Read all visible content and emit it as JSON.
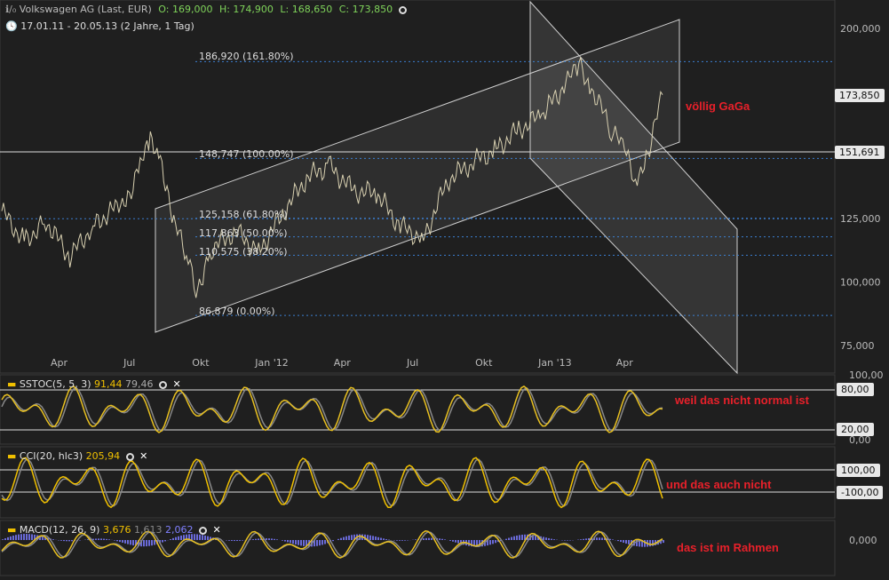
{
  "header": {
    "symbol": "Volkswagen AG (Last, EUR)",
    "open": "O: 169,000",
    "high": "H: 174,900",
    "low": "L: 168,650",
    "close": "C: 173,850",
    "period": "17.01.11 - 20.05.13 (2 Jahre, 1 Tag)",
    "colors": {
      "open": "#7fd35a",
      "high": "#7fd35a",
      "low": "#7fd35a",
      "close": "#7fd35a"
    }
  },
  "main": {
    "price_labels": {
      "current": "173,850",
      "level": "151,691"
    },
    "fib_labels": [
      "186,920 (161.80%)",
      "148,747 (100.00%)",
      "125,158 (61.80%)",
      "117,863 (50.00%)",
      "110,575 (38.20%)",
      "86,879 (0.00%)"
    ],
    "annotation": "völlig GaGa"
  },
  "stoch": {
    "label": "SSTOC(5, 5, 3)",
    "v1": "91,44",
    "v2": "79,46",
    "level_hi": "80,00",
    "level_lo": "20,00",
    "annotation": "weil das nicht normal ist"
  },
  "cci": {
    "label": "CCI(20, hlc3)",
    "v1": "205,94",
    "level_hi": "100,00",
    "level_lo": "-100,00",
    "annotation": "und das auch nicht"
  },
  "macd": {
    "label": "MACD(12, 26, 9)",
    "v1": "3,676",
    "v2": "1,613",
    "v3": "2,062",
    "level_zero": "0,000",
    "annotation": "das ist im Rahmen"
  },
  "chart_data": [
    {
      "type": "line",
      "title": "Volkswagen AG (Last, EUR)",
      "x_ticks": [
        "Apr",
        "Jul",
        "Okt",
        "Jan '12",
        "Apr",
        "Jul",
        "Okt",
        "Jan '13",
        "Apr"
      ],
      "y_ticks": [
        "75,000",
        "100,000",
        "125,000",
        "151,691",
        "173,850",
        "200,000"
      ],
      "ylim": [
        75,
        200
      ],
      "series": [
        {
          "x": [
            "2011-01-17",
            "2011-02-15",
            "2011-03-15",
            "2011-04-15",
            "2011-05-15",
            "2011-06-15",
            "2011-07-01",
            "2011-07-15",
            "2011-07-28",
            "2011-08-10",
            "2011-08-25",
            "2011-09-15",
            "2011-09-25",
            "2011-10-15",
            "2011-11-15",
            "2011-12-15",
            "2012-01-15",
            "2012-02-15",
            "2012-03-15",
            "2012-04-15",
            "2012-05-15",
            "2012-06-15",
            "2012-07-15",
            "2012-08-15",
            "2012-09-15",
            "2012-10-15",
            "2012-11-15",
            "2012-12-15",
            "2013-01-15",
            "2013-02-01",
            "2013-02-15",
            "2013-03-15",
            "2013-04-01",
            "2013-04-15",
            "2013-05-01",
            "2013-05-20"
          ],
          "values": [
            128,
            116,
            124,
            110,
            122,
            130,
            135,
            146,
            155,
            150,
            126,
            108,
            96,
            113,
            120,
            112,
            127,
            141,
            146,
            136,
            135,
            122,
            117,
            140,
            147,
            152,
            160,
            166,
            178,
            186,
            178,
            160,
            152,
            140,
            151,
            173.85
          ]
        }
      ]
    },
    {
      "type": "line",
      "title": "SSTOC(5, 5, 3)",
      "ylim": [
        0,
        100
      ],
      "y_ticks": [
        "0,00",
        "20,00",
        "80,00",
        "100,00"
      ]
    },
    {
      "type": "line",
      "title": "CCI(20, hlc3)",
      "y_ticks": [
        "-100,00",
        "100,00"
      ]
    },
    {
      "type": "area",
      "title": "MACD(12, 26, 9)",
      "y_ticks": [
        "0,000"
      ]
    }
  ]
}
